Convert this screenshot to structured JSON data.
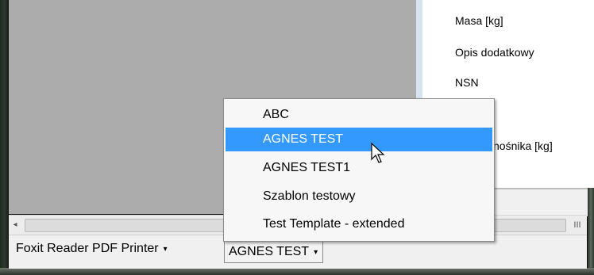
{
  "panel": {
    "fields": [
      "Masa [kg]",
      "Opis dodatkowy",
      "NSN",
      "nośnika [kg]"
    ]
  },
  "scrollbar": {
    "left_arrow": "◂",
    "right_grip": "III"
  },
  "status_bar": {
    "printer_label": "Foxit Reader PDF Printer",
    "printer_arrow": "▾",
    "template_selected": "AGNES TEST",
    "template_arrow": "▾"
  },
  "template_dropdown": {
    "items": [
      "ABC",
      "AGNES TEST",
      "AGNES TEST1",
      "Szablon testowy",
      "Test Template - extended"
    ],
    "selected_index": 1
  },
  "colors": {
    "highlight": "#3399ff",
    "gray_area": "#acacac"
  }
}
